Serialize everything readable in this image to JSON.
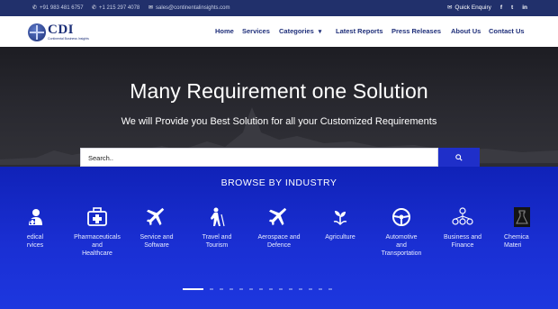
{
  "topbar": {
    "phone1": "+91 983 481 6757",
    "phone2": "+1 215 297 4078",
    "email": "sales@continentalinsights.com",
    "enquiry": "Quick Enquiry",
    "social": [
      "f",
      "t",
      "in"
    ]
  },
  "logo": {
    "title": "CDI",
    "subtitle": "Continental Business Insights"
  },
  "nav": {
    "items": [
      "Home",
      "Services",
      "Categories",
      "Latest Reports",
      "Press Releases",
      "About Us",
      "Contact Us"
    ]
  },
  "hero": {
    "title": "Many Requirement one Solution",
    "subtitle": "We will Provide you Best Solution for all your Customized Requirements"
  },
  "search": {
    "placeholder": "Search.."
  },
  "industry": {
    "title": "BROWSE BY INDUSTRY",
    "items": [
      {
        "label": "edical\nrvices",
        "icon": "medical-icon"
      },
      {
        "label": "Pharmaceuticals\nand\nHealthcare",
        "icon": "medical-kit-icon"
      },
      {
        "label": "Service and\nSoftware",
        "icon": "airplane-icon"
      },
      {
        "label": "Travel and\nTourism",
        "icon": "traveler-icon"
      },
      {
        "label": "Aerospace and\nDefence",
        "icon": "airplane-icon"
      },
      {
        "label": "Agriculture",
        "icon": "sprout-icon"
      },
      {
        "label": "Automotive\nand\nTransportation",
        "icon": "steering-wheel-icon"
      },
      {
        "label": "Business and\nFinance",
        "icon": "business-network-icon"
      },
      {
        "label": "Chemica\nMateri",
        "icon": "chemical-icon"
      }
    ],
    "dots_total": 14,
    "dots_active": 0
  },
  "colors": {
    "topbar": "#21306b",
    "nav_text": "#1f2f7a",
    "industry_bg": "#1a2fd3",
    "search_button": "#1f2fc9"
  }
}
